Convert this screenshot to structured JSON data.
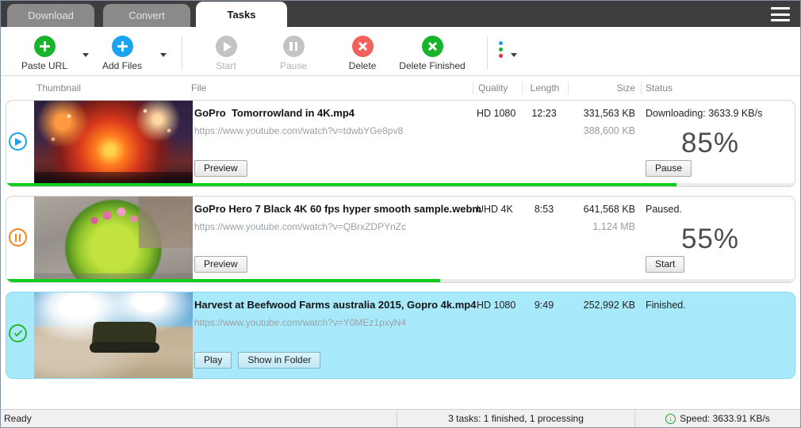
{
  "tabs": [
    {
      "label": "Download",
      "active": false
    },
    {
      "label": "Convert",
      "active": false
    },
    {
      "label": "Tasks",
      "active": true
    }
  ],
  "toolbar": {
    "paste_url": "Paste URL",
    "add_files": "Add Files",
    "start": "Start",
    "pause": "Pause",
    "delete": "Delete",
    "delete_finished": "Delete Finished"
  },
  "table": {
    "headers": [
      "Thumbnail",
      "File",
      "Quality",
      "Length",
      "Size",
      "Status"
    ]
  },
  "tasks": [
    {
      "name": "GoPro  Tomorrowland in 4K.mp4",
      "url": "https://www.youtube.com/watch?v=tdwbYGe8pv8",
      "quality": "HD 1080",
      "length": "12:23",
      "size": "331,563 KB",
      "size_total": "388,600 KB",
      "status": "Downloading: 3633.9 KB/s",
      "progress_percent": 85,
      "progress_label": "85%",
      "state": "downloading",
      "buttons": [
        "Preview"
      ],
      "action_button": "Pause"
    },
    {
      "name": "GoPro Hero 7 Black 4K 60 fps hyper smooth sample.webm",
      "url": "https://www.youtube.com/watch?v=QBrxZDPYnZc",
      "quality": "UHD 4K",
      "length": "8:53",
      "size": "641,568 KB",
      "size_total": "1,124 MB",
      "status": "Paused.",
      "progress_percent": 55,
      "progress_label": "55%",
      "state": "paused",
      "buttons": [
        "Preview"
      ],
      "action_button": "Start"
    },
    {
      "name": "Harvest at Beefwood Farms australia 2015, Gopro 4k.mp4",
      "url": "https://www.youtube.com/watch?v=Y0MEz1pxyN4",
      "quality": "HD 1080",
      "length": "9:49",
      "size": "252,992 KB",
      "status": "Finished.",
      "state": "finished",
      "selected": true,
      "buttons": [
        "Play",
        "Show in Folder"
      ]
    }
  ],
  "statusbar": {
    "left": "Ready",
    "tasks_summary": "3 tasks: 1 finished, 1 processing",
    "speed": "Speed: 3633.91 KB/s"
  },
  "colors": {
    "accent_green": "#17b32a",
    "accent_blue": "#1aa3f0",
    "accent_red": "#f2615c",
    "accent_orange": "#f0861c",
    "progress_green": "#0bcf1c",
    "selected_row_bg": "#a8eafb",
    "titlebar_bg": "#3e3e3e"
  }
}
